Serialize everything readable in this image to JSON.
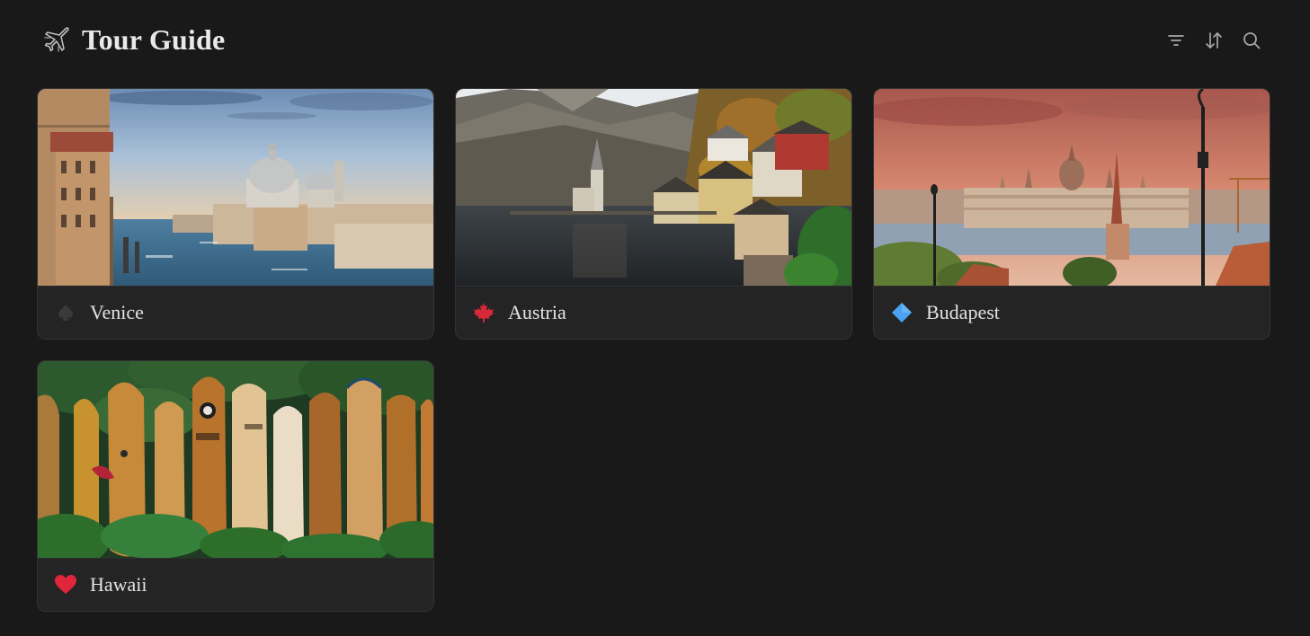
{
  "header": {
    "title": "Tour Guide",
    "title_icon": "airplane-icon"
  },
  "toolbar": {
    "filter_icon": "filter-icon",
    "sort_icon": "sort-icon",
    "search_icon": "search-icon"
  },
  "cards": [
    {
      "title": "Venice",
      "icon": "spade-icon",
      "icon_color": "#3a3a3a",
      "image": "venice-grand-canal-photo"
    },
    {
      "title": "Austria",
      "icon": "maple-leaf-icon",
      "icon_color": "#d6293a",
      "image": "hallstatt-lake-village-photo"
    },
    {
      "title": "Budapest",
      "icon": "diamond-icon",
      "icon_color": "#4aa3f0",
      "image": "budapest-parliament-photo"
    },
    {
      "title": "Hawaii",
      "icon": "heart-icon",
      "icon_color": "#e0263a",
      "image": "surfboards-fence-photo"
    }
  ]
}
